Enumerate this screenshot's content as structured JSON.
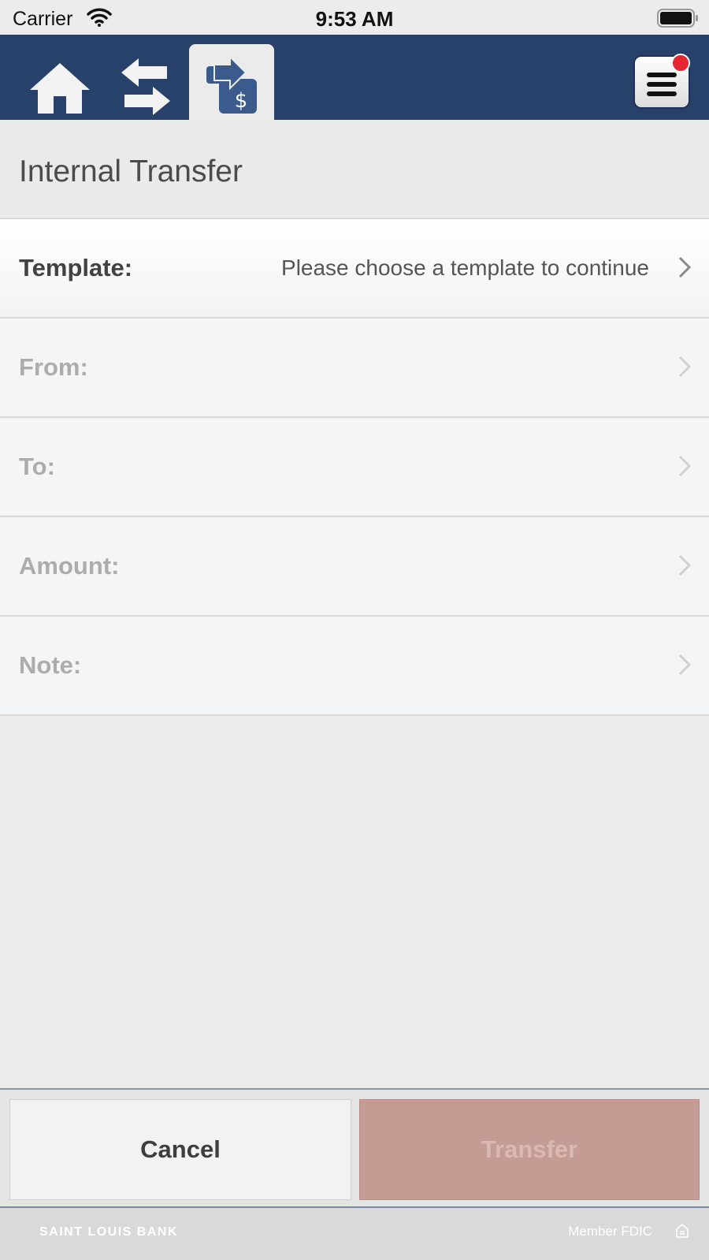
{
  "status_bar": {
    "carrier": "Carrier",
    "time": "9:53 AM"
  },
  "nav": {
    "icons": [
      "home-icon",
      "transfer-arrows-icon",
      "transfer-dollar-icon",
      "menu-icon"
    ],
    "bar_color": "#27416a",
    "notification_color": "#e52733"
  },
  "page": {
    "title": "Internal Transfer"
  },
  "form": {
    "rows": [
      {
        "label": "Template:",
        "value": "Please choose a template to continue"
      },
      {
        "label": "From:",
        "value": ""
      },
      {
        "label": "To:",
        "value": ""
      },
      {
        "label": "Amount:",
        "value": ""
      },
      {
        "label": "Note:",
        "value": ""
      }
    ]
  },
  "actions": {
    "cancel_label": "Cancel",
    "transfer_label": "Transfer",
    "transfer_color": "#c59c93"
  },
  "footer": {
    "bank_name": "SAINT LOUIS BANK",
    "member_text": "Member FDIC"
  }
}
